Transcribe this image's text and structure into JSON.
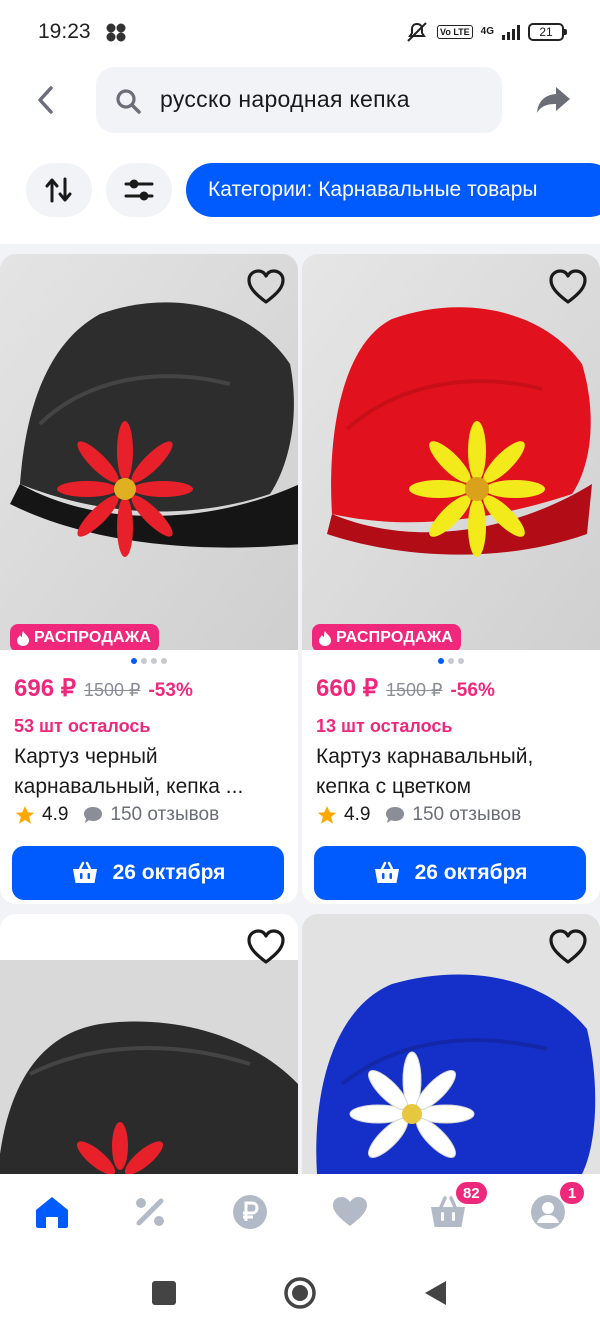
{
  "status_bar": {
    "time": "19:23",
    "network": "4G",
    "volte": "Vo LTE",
    "battery": "21"
  },
  "search": {
    "query": "русско народная кепка",
    "back_icon": "chevron-left-icon",
    "search_icon": "search-icon",
    "share_icon": "share-arrow-icon"
  },
  "filters": {
    "sort_icon": "sort-arrows-icon",
    "filter_icon": "sliders-icon",
    "category_label": "Категории: Карнавальные товары"
  },
  "products": [
    {
      "sale_label": "РАСПРОДАЖА",
      "price": "696 ₽",
      "old_price": "1500 ₽",
      "discount": "-53%",
      "stock": "53 шт осталось",
      "title": "Картуз черный карнавальный, кепка ...",
      "rating": "4.9",
      "reviews": "150 отзывов",
      "delivery_label": "26 октября",
      "cap_color": "#2a2a2a",
      "flower_color": "#e8202a",
      "image_dots": 4
    },
    {
      "sale_label": "РАСПРОДАЖА",
      "price": "660 ₽",
      "old_price": "1500 ₽",
      "discount": "-56%",
      "stock": "13 шт осталось",
      "title": "Картуз карнавальный, кепка с цветком",
      "rating": "4.9",
      "reviews": "150 отзывов",
      "delivery_label": "26 октября",
      "cap_color": "#e1121d",
      "flower_color": "#f2ea1a",
      "image_dots": 3
    },
    {
      "cap_color": "#2a2a2a",
      "flower_color": "#e8202a"
    },
    {
      "cap_color": "#1530c8",
      "flower_color": "#ffffff"
    }
  ],
  "bottom_nav": {
    "items": [
      "home-icon",
      "percent-icon",
      "ruble-icon",
      "heart-icon",
      "cart-icon",
      "profile-icon"
    ],
    "cart_badge": "82",
    "profile_badge": "1",
    "active_color": "#005bff",
    "inactive_color": "#b3bac7"
  },
  "colors": {
    "accent": "#005bff",
    "sale": "#f0287c"
  }
}
